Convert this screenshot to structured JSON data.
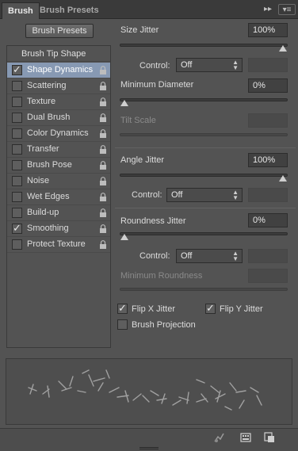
{
  "tabs": {
    "active": "Brush",
    "inactive": "Brush Presets",
    "collapse_glyph": "▸▸",
    "menu_glyph": "▾≡"
  },
  "presets_button": "Brush Presets",
  "brush_tip_shape": "Brush Tip Shape",
  "list_items": [
    {
      "label": "Shape Dynamics",
      "checked": true,
      "selected": true
    },
    {
      "label": "Scattering",
      "checked": false
    },
    {
      "label": "Texture",
      "checked": false
    },
    {
      "label": "Dual Brush",
      "checked": false
    },
    {
      "label": "Color Dynamics",
      "checked": false
    },
    {
      "label": "Transfer",
      "checked": false
    },
    {
      "label": "Brush Pose",
      "checked": false
    },
    {
      "label": "Noise",
      "checked": false
    },
    {
      "label": "Wet Edges",
      "checked": false
    },
    {
      "label": "Build-up",
      "checked": false
    },
    {
      "label": "Smoothing",
      "checked": true
    },
    {
      "label": "Protect Texture",
      "checked": false
    }
  ],
  "size_jitter": {
    "label": "Size Jitter",
    "value": "100%",
    "level": 1.0
  },
  "control_1": {
    "label": "Control:",
    "value": "Off"
  },
  "minimum_diameter": {
    "label": "Minimum Diameter",
    "value": "0%",
    "level": 0.0
  },
  "tilt_scale": {
    "label": "Tilt Scale"
  },
  "angle_jitter": {
    "label": "Angle Jitter",
    "value": "100%",
    "level": 1.0
  },
  "control_2": {
    "label": "Control:",
    "value": "Off"
  },
  "roundness_jitter": {
    "label": "Roundness Jitter",
    "value": "0%",
    "level": 0.0
  },
  "control_3": {
    "label": "Control:",
    "value": "Off"
  },
  "minimum_roundness": {
    "label": "Minimum Roundness"
  },
  "flip_x": {
    "label": "Flip X Jitter",
    "checked": true
  },
  "flip_y": {
    "label": "Flip Y Jitter",
    "checked": true
  },
  "brush_projection": {
    "label": "Brush Projection",
    "checked": false
  },
  "icons": {
    "lock": "lock-icon",
    "toggle_preview": "brush-toggle-icon",
    "grid": "grid-icon",
    "new_preset": "new-preset-icon"
  }
}
